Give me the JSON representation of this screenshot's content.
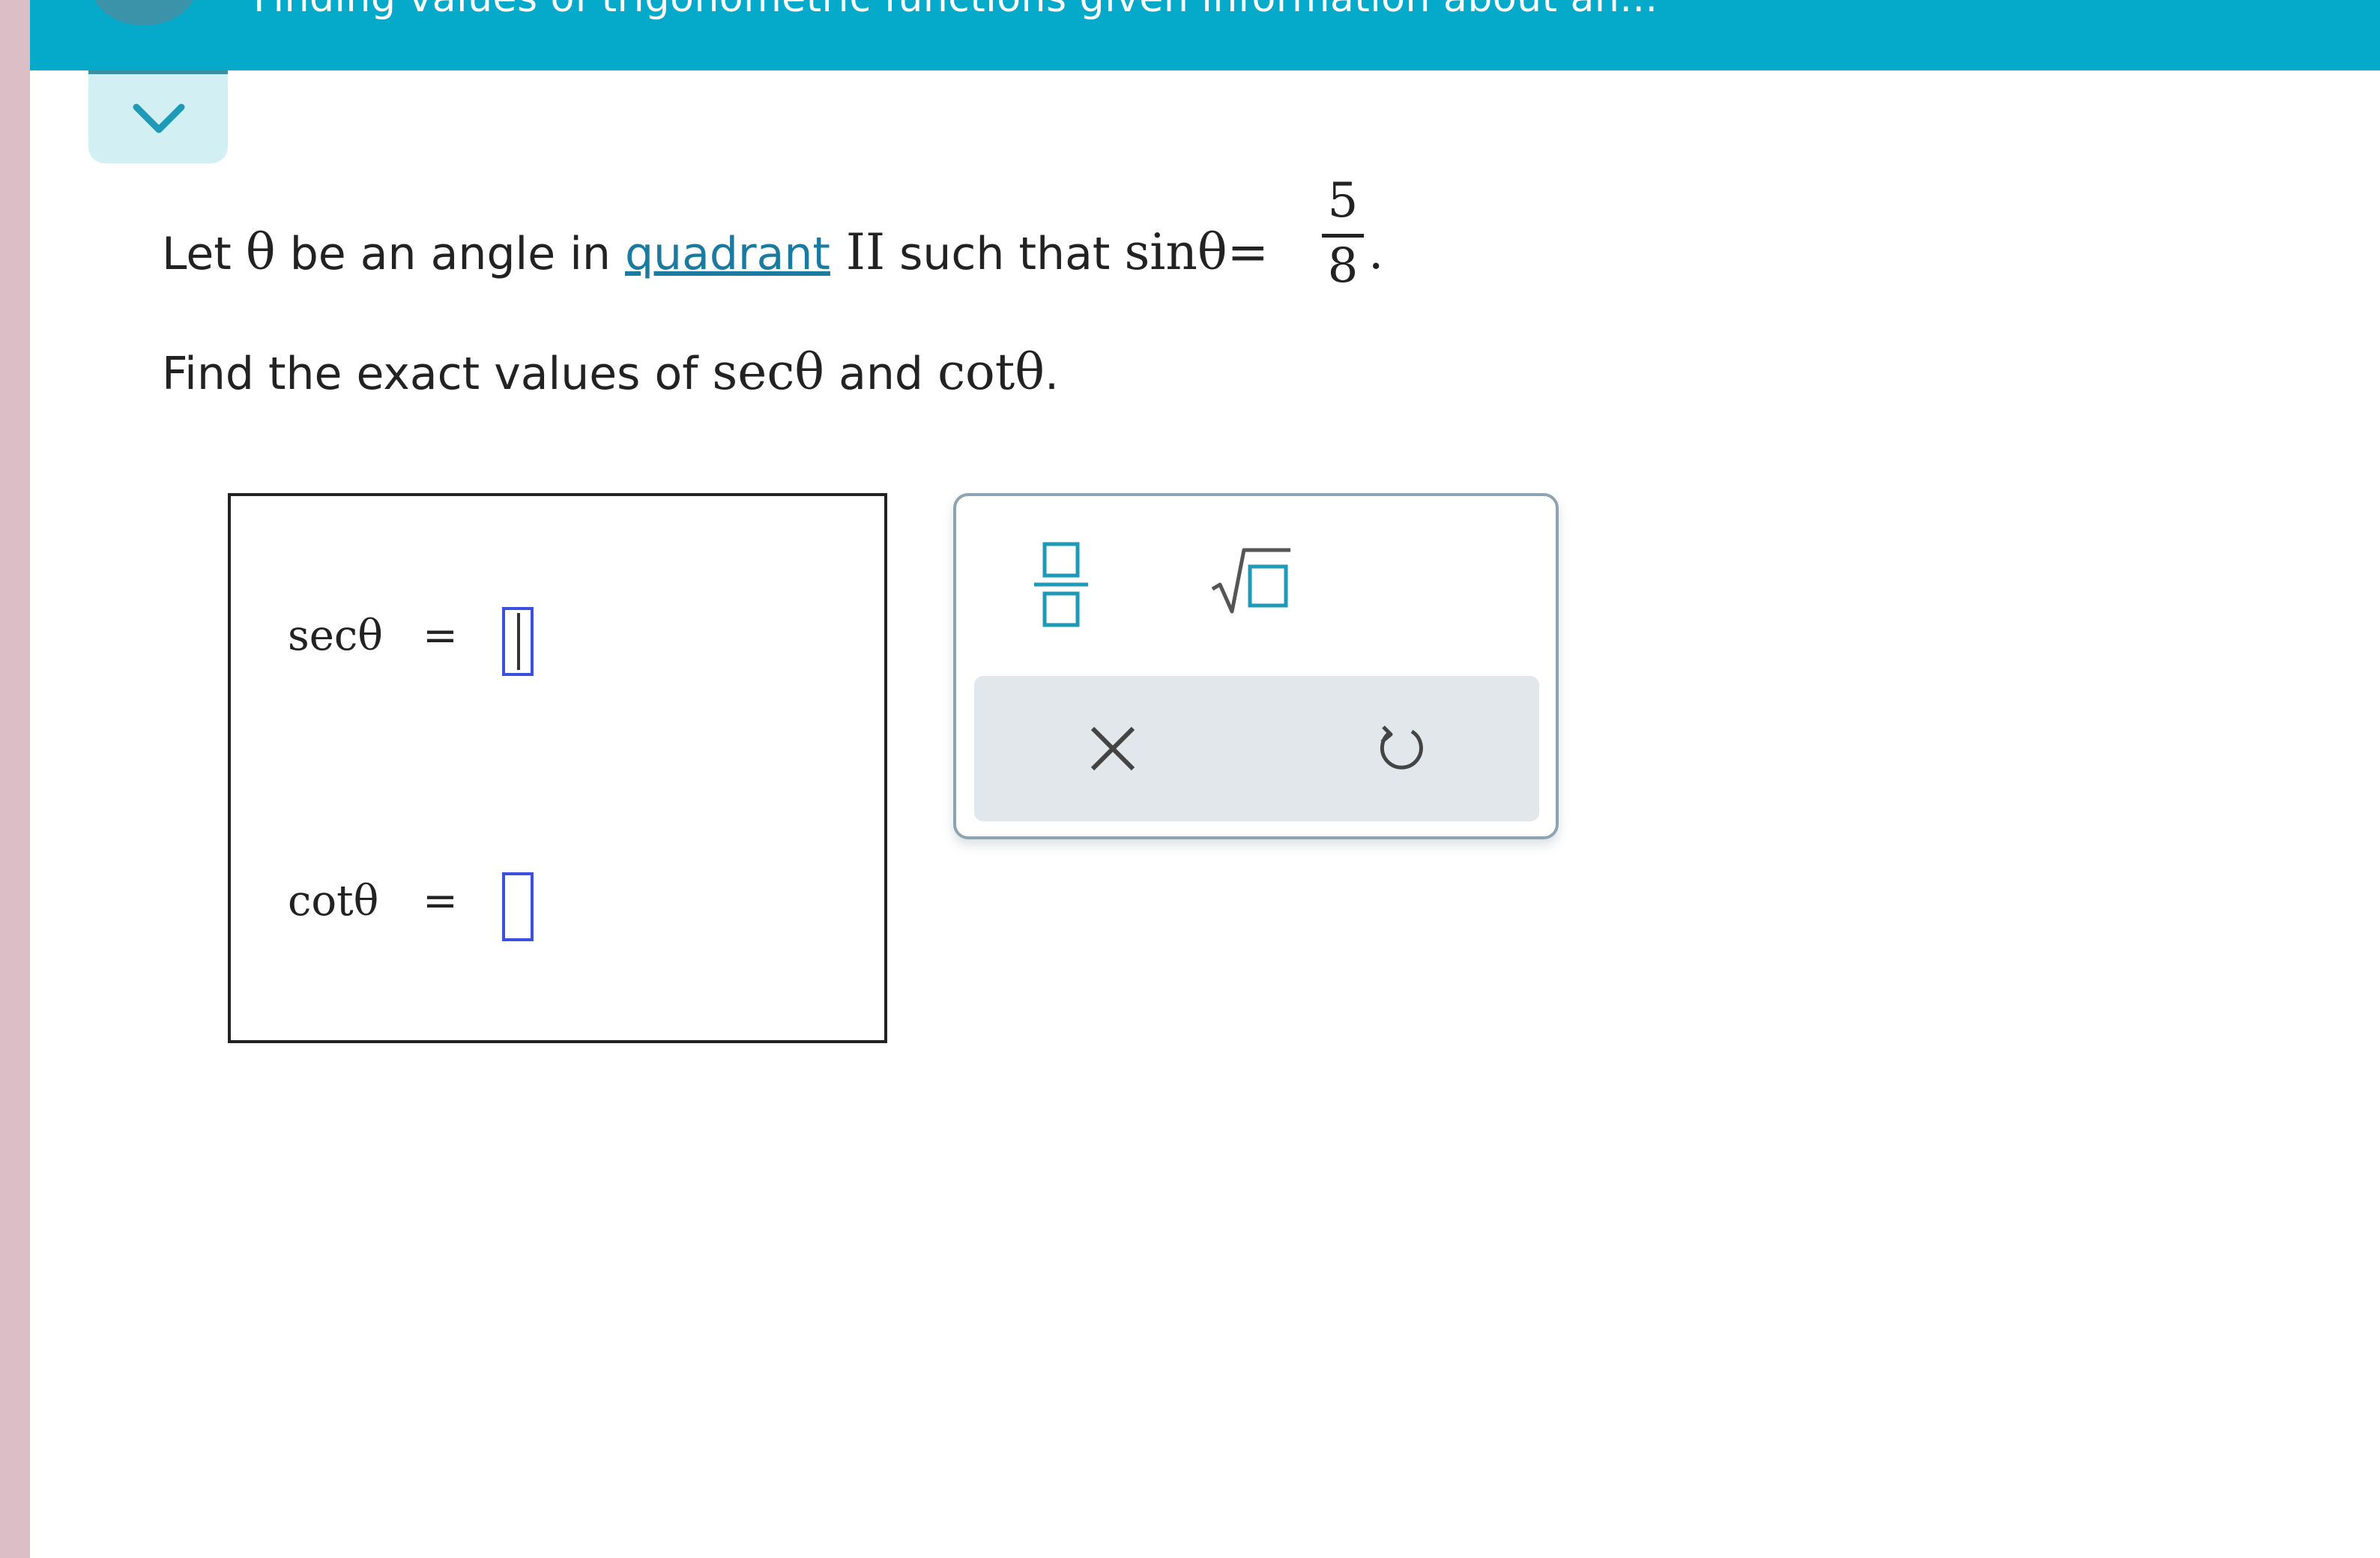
{
  "header": {
    "title": "Finding values of trigonometric functions given information about an..."
  },
  "problem": {
    "line1_prefix": "Let ",
    "theta": "θ",
    "line1_mid": " be an angle in ",
    "quadrant_link": "quadrant",
    "quadrant_numeral": " II",
    "line1_suffix": " such that ",
    "sin_expr": "sinθ=",
    "frac_num": "5",
    "frac_den": "8",
    "frac_period": ".",
    "line2_prefix": "Find the exact values of ",
    "sec_expr": "secθ",
    "line2_and": " and ",
    "cot_expr": "cotθ",
    "line2_period": "."
  },
  "answer": {
    "sec_label": "secθ",
    "cot_label": "cotθ",
    "equals": "="
  },
  "palette": {
    "fraction_icon": "fraction-icon",
    "sqrt_icon": "square-root-icon",
    "clear_icon": "close-icon",
    "undo_icon": "undo-icon"
  },
  "colors": {
    "header_bg": "#05a9c9",
    "accent": "#1a7aa0",
    "input_border": "#3b4fe0",
    "palette_icon": "#1e9ab8"
  }
}
